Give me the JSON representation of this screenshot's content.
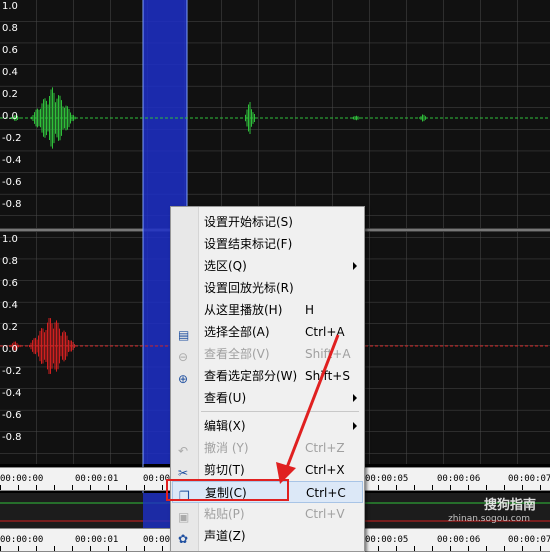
{
  "axis_labels_top": [
    "1.0",
    "0.8",
    "0.6",
    "0.4",
    "0.2",
    "0.0",
    "-0.2",
    "-0.4",
    "-0.6",
    "-0.8"
  ],
  "axis_labels_bottom": [
    "1.0",
    "0.8",
    "0.6",
    "0.4",
    "0.2",
    "0.0",
    "-0.2",
    "-0.4",
    "-0.6",
    "-0.8"
  ],
  "timeline_top": [
    "00:00:00",
    "00:00:01",
    "00:00:0",
    "00:00:05",
    "00:00:06",
    "00:00:07"
  ],
  "timeline_bottom": [
    "00:00:00",
    "00:00:01",
    "00:00:0",
    "00:00:05",
    "00:00:06",
    "00:00:07"
  ],
  "watermark": {
    "text": "搜狗指南",
    "url": "zhinan.sogou.com"
  },
  "context_menu": {
    "items": [
      {
        "label": "设置开始标记(S)",
        "shortcut": "",
        "submenu": false,
        "disabled": false
      },
      {
        "label": "设置结束标记(F)",
        "shortcut": "",
        "submenu": false,
        "disabled": false
      },
      {
        "label": "选区(Q)",
        "shortcut": "",
        "submenu": true,
        "disabled": false
      },
      {
        "label": "设置回放光标(R)",
        "shortcut": "",
        "submenu": false,
        "disabled": false
      },
      {
        "label": "从这里播放(H)",
        "shortcut": "H",
        "submenu": false,
        "disabled": false
      },
      {
        "label": "选择全部(A)",
        "shortcut": "Ctrl+A",
        "submenu": false,
        "disabled": false,
        "icon": "select-all-icon"
      },
      {
        "label": "查看全部(V)",
        "shortcut": "Shift+A",
        "submenu": false,
        "disabled": true,
        "icon": "zoom-out-icon"
      },
      {
        "label": "查看选定部分(W)",
        "shortcut": "Shift+S",
        "submenu": false,
        "disabled": false,
        "icon": "zoom-selection-icon"
      },
      {
        "label": "查看(U)",
        "shortcut": "",
        "submenu": true,
        "disabled": false
      },
      {
        "label": "编辑(X)",
        "shortcut": "",
        "submenu": true,
        "disabled": false
      },
      {
        "label": "撤消 (Y)",
        "shortcut": "Ctrl+Z",
        "submenu": false,
        "disabled": true,
        "icon": "undo-icon"
      },
      {
        "label": "剪切(T)",
        "shortcut": "Ctrl+X",
        "submenu": false,
        "disabled": false,
        "icon": "scissors-icon"
      },
      {
        "label": "复制(C)",
        "shortcut": "Ctrl+C",
        "submenu": false,
        "disabled": false,
        "icon": "copy-icon",
        "highlighted": true
      },
      {
        "label": "粘贴(P)",
        "shortcut": "Ctrl+V",
        "submenu": false,
        "disabled": true,
        "icon": "paste-icon"
      },
      {
        "label": "声道(Z)",
        "shortcut": "",
        "submenu": false,
        "disabled": false,
        "icon": "channels-icon"
      }
    ]
  },
  "colors": {
    "left_wave": "#2fbf3a",
    "right_wave": "#d02020",
    "selection": "#1d2fc8",
    "annotation": "#e02020"
  }
}
